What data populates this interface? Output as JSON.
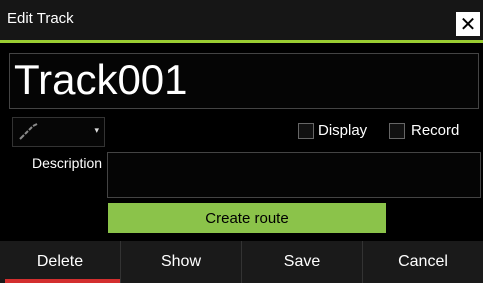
{
  "dialog": {
    "title": "Edit Track",
    "close_icon": "close-icon"
  },
  "track": {
    "name": "Track001",
    "style_icon": "track-line-icon",
    "description": ""
  },
  "options": {
    "display_label": "Display",
    "display_checked": false,
    "record_label": "Record",
    "record_checked": false
  },
  "description_label": "Description",
  "create_route_label": "Create route",
  "buttons": [
    "Delete",
    "Show",
    "Save",
    "Cancel"
  ],
  "colors": {
    "accent": "#9acd32",
    "create_button": "#8bc34a",
    "active_indicator": "#d32f2f"
  }
}
